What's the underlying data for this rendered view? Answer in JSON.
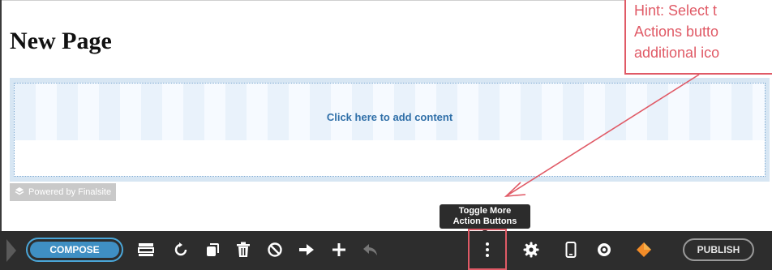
{
  "page": {
    "title": "New Page"
  },
  "content": {
    "add_content_text": "Click here to add content"
  },
  "powered_by": {
    "text": "Powered by Finalsite"
  },
  "hint": {
    "lines": [
      "Hint: Select t",
      "Actions butto",
      "additional ico"
    ]
  },
  "tooltip": {
    "line1": "Toggle More",
    "line2": "Action Buttons"
  },
  "toolbar": {
    "compose_label": "COMPOSE",
    "publish_label": "PUBLISH",
    "icons": [
      "layout-icon",
      "refresh-icon",
      "copy-icon",
      "trash-icon",
      "ban-icon",
      "arrow-right-icon",
      "plus-icon",
      "reply-icon",
      "more-vertical-icon",
      "gear-icon",
      "mobile-icon",
      "eye-icon",
      "finalsite-logo-icon"
    ]
  },
  "colors": {
    "accent": "#3f8fc3",
    "hint": "#e05a66",
    "toolbar": "#2d2d2d",
    "logo": "#f28c28"
  }
}
